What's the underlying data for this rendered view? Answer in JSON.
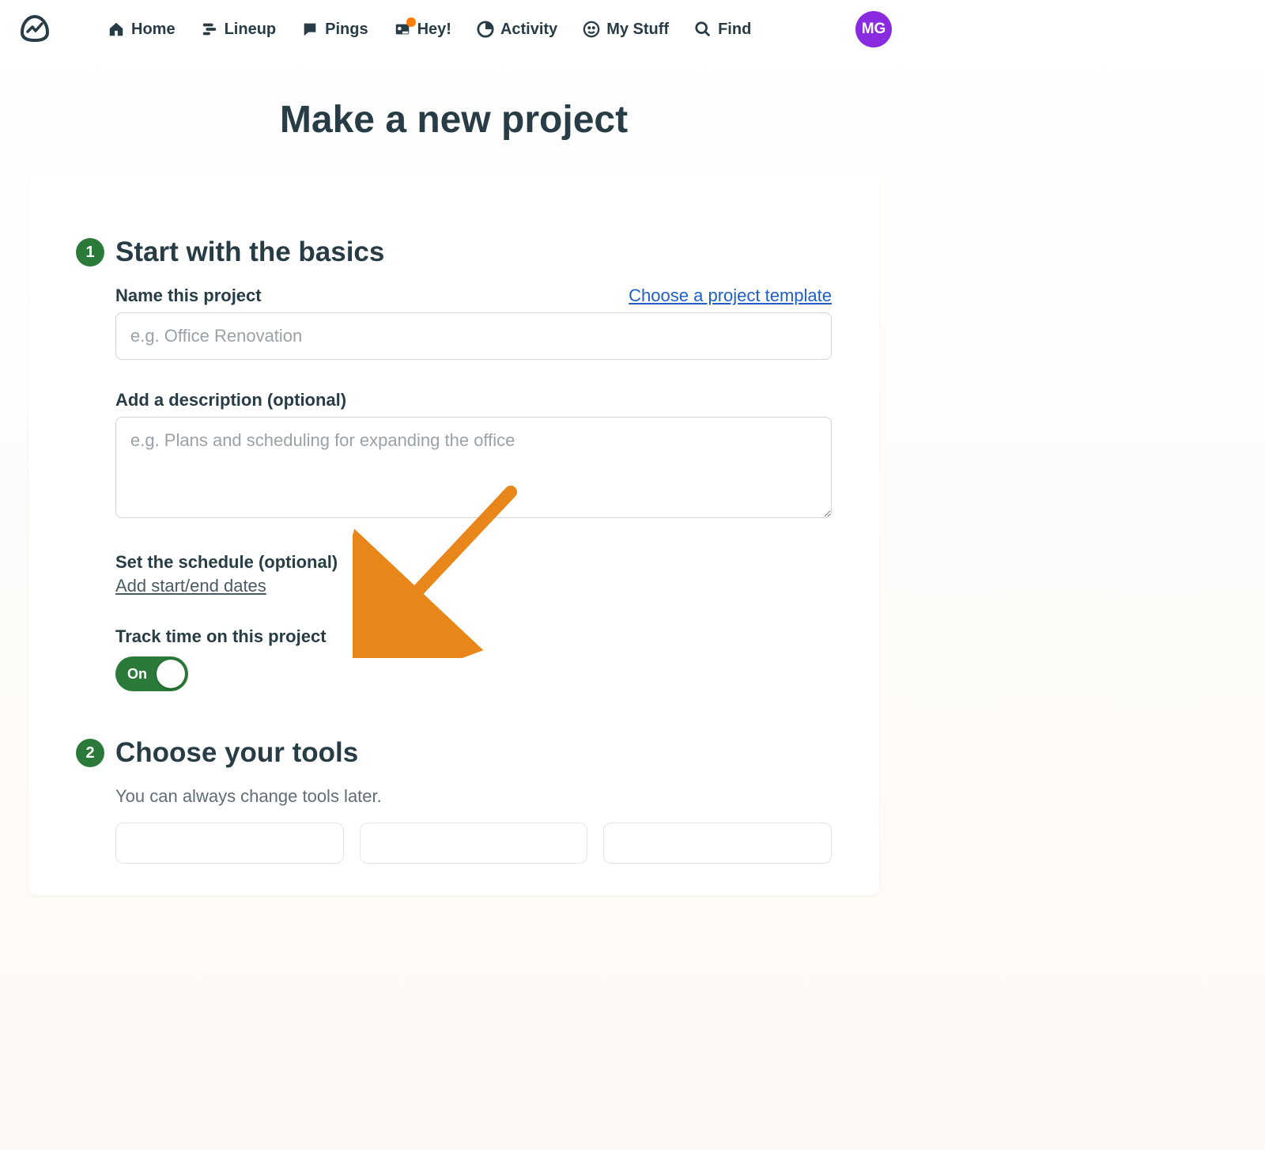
{
  "nav": {
    "home": "Home",
    "lineup": "Lineup",
    "pings": "Pings",
    "hey": "Hey!",
    "activity": "Activity",
    "mystuff": "My Stuff",
    "find": "Find"
  },
  "avatar_initials": "MG",
  "page_title": "Make a new project",
  "section1": {
    "step": "1",
    "title": "Start with the basics",
    "name_label": "Name this project",
    "template_link": "Choose a project template",
    "name_placeholder": "e.g. Office Renovation",
    "desc_label": "Add a description (optional)",
    "desc_placeholder": "e.g. Plans and scheduling for expanding the office",
    "schedule_label": "Set the schedule (optional)",
    "dates_link": "Add start/end dates",
    "track_label": "Track time on this project",
    "toggle_state": "On"
  },
  "section2": {
    "step": "2",
    "title": "Choose your tools",
    "subtext": "You can always change tools later."
  }
}
